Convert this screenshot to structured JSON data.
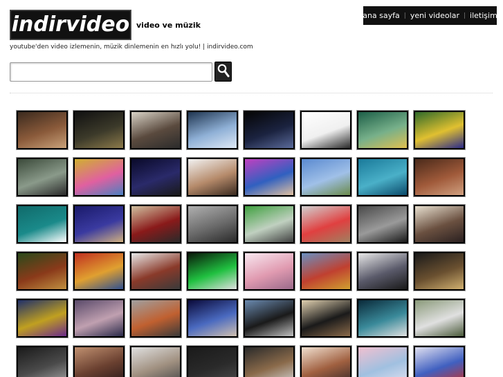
{
  "brand": {
    "logo_text": "indirvideo",
    "heading": "video ve müzik",
    "subline": "youtube'den video izlemenin, müzik dinlemenin en hızlı yolu! | indirvideo.com"
  },
  "nav": {
    "items": [
      {
        "label": "ana sayfa"
      },
      {
        "label": "yeni videolar"
      },
      {
        "label": "iletişim"
      }
    ]
  },
  "search": {
    "value": "",
    "placeholder": "",
    "button_icon": "magnifier-icon"
  },
  "thumbnails": [
    {
      "colors": [
        "#3b2a1e",
        "#8a5a3a",
        "#c9a27a"
      ]
    },
    {
      "colors": [
        "#111111",
        "#3c3a2a",
        "#8c7a4a"
      ]
    },
    {
      "colors": [
        "#d8d2c6",
        "#5a4a3e",
        "#2b2b2b"
      ]
    },
    {
      "colors": [
        "#1f3550",
        "#8fb0d6",
        "#dfe9f6"
      ]
    },
    {
      "colors": [
        "#050505",
        "#1b2340",
        "#5a6a9a"
      ]
    },
    {
      "colors": [
        "#ffffff",
        "#f0f0f0",
        "#2a2a2a"
      ]
    },
    {
      "colors": [
        "#1d5f48",
        "#77b08a",
        "#e0c050"
      ]
    },
    {
      "colors": [
        "#2f6a2a",
        "#e0c030",
        "#2a2a8a"
      ]
    },
    {
      "colors": [
        "#3b4a3a",
        "#8a9a8a",
        "#2a2a2a"
      ]
    },
    {
      "colors": [
        "#d0b030",
        "#e060a0",
        "#4a80c0"
      ]
    },
    {
      "colors": [
        "#0a0a2a",
        "#2a2a6a",
        "#1a1a1a"
      ]
    },
    {
      "colors": [
        "#f2f2f2",
        "#b58a6a",
        "#3a2a20"
      ]
    },
    {
      "colors": [
        "#c040c0",
        "#3060c0",
        "#e0c0a0"
      ]
    },
    {
      "colors": [
        "#5a8ad0",
        "#a0c0e8",
        "#6a8a4a"
      ]
    },
    {
      "colors": [
        "#1a7a9a",
        "#4ab0c8",
        "#0a4a6a"
      ]
    },
    {
      "colors": [
        "#4a2a1a",
        "#a05a3a",
        "#d0a080"
      ]
    },
    {
      "colors": [
        "#106a6a",
        "#1a8a8a",
        "#ffffff"
      ]
    },
    {
      "colors": [
        "#1a1a6a",
        "#3a3aa0",
        "#d0b080"
      ]
    },
    {
      "colors": [
        "#d0c0a0",
        "#8a1a1a",
        "#2a2a2a"
      ]
    },
    {
      "colors": [
        "#b0b0b0",
        "#6a6a6a",
        "#2a2a2a"
      ]
    },
    {
      "colors": [
        "#40a040",
        "#c0d0c0",
        "#404040"
      ]
    },
    {
      "colors": [
        "#d0d0d0",
        "#e04040",
        "#a08060"
      ]
    },
    {
      "colors": [
        "#4a4a4a",
        "#9a9a9a",
        "#1a1a1a"
      ]
    },
    {
      "colors": [
        "#e8e0d0",
        "#6a5040",
        "#2a2020"
      ]
    },
    {
      "colors": [
        "#2a4a1a",
        "#8a3a1a",
        "#c09040"
      ]
    },
    {
      "colors": [
        "#c03020",
        "#e0a030",
        "#305090"
      ]
    },
    {
      "colors": [
        "#e8e8e8",
        "#8a3a2a",
        "#3a3a3a"
      ]
    },
    {
      "colors": [
        "#0a1a0a",
        "#20c040",
        "#e0e0e0"
      ]
    },
    {
      "colors": [
        "#f8e8f0",
        "#e09ab0",
        "#9a6a8a"
      ]
    },
    {
      "colors": [
        "#6a90c0",
        "#c04030",
        "#d0a030"
      ]
    },
    {
      "colors": [
        "#e8e8e8",
        "#5a5a6a",
        "#1a1a1a"
      ]
    },
    {
      "colors": [
        "#1a1a1a",
        "#6a5030",
        "#d0b070"
      ]
    },
    {
      "colors": [
        "#20306a",
        "#c0a020",
        "#6a2a8a"
      ]
    },
    {
      "colors": [
        "#5a4a6a",
        "#c0a0b0",
        "#2a2a4a"
      ]
    },
    {
      "colors": [
        "#a0a0a0",
        "#c06030",
        "#3a3a3a"
      ]
    },
    {
      "colors": [
        "#0a0a3a",
        "#4a6ac0",
        "#d0c0b0"
      ]
    },
    {
      "colors": [
        "#6a8ab0",
        "#1a1a1a",
        "#c0c0c0"
      ]
    },
    {
      "colors": [
        "#e0d0b0",
        "#1a1a1a",
        "#8a6a4a"
      ]
    },
    {
      "colors": [
        "#0a2a3a",
        "#3a8a9a",
        "#e0e0e0"
      ]
    },
    {
      "colors": [
        "#8a9a7a",
        "#e0e0e0",
        "#4a5a3a"
      ]
    },
    {
      "colors": [
        "#1a1a1a",
        "#4a4a4a",
        "#a0a0a0"
      ]
    },
    {
      "colors": [
        "#c09070",
        "#6a4030",
        "#2a1a1a"
      ]
    },
    {
      "colors": [
        "#e0e0e0",
        "#a09080",
        "#4a4a4a"
      ]
    },
    {
      "colors": [
        "#1a1a1a",
        "#2a2a2a",
        "#4a4a4a"
      ]
    },
    {
      "colors": [
        "#2a2a2a",
        "#8a6a4a",
        "#d0d0d0"
      ]
    },
    {
      "colors": [
        "#f0e0d0",
        "#a06040",
        "#3a2a2a"
      ]
    },
    {
      "colors": [
        "#f0c0d0",
        "#a0c0e0",
        "#e0e0f0"
      ]
    },
    {
      "colors": [
        "#e0e0f0",
        "#4060c0",
        "#c03030"
      ]
    }
  ]
}
